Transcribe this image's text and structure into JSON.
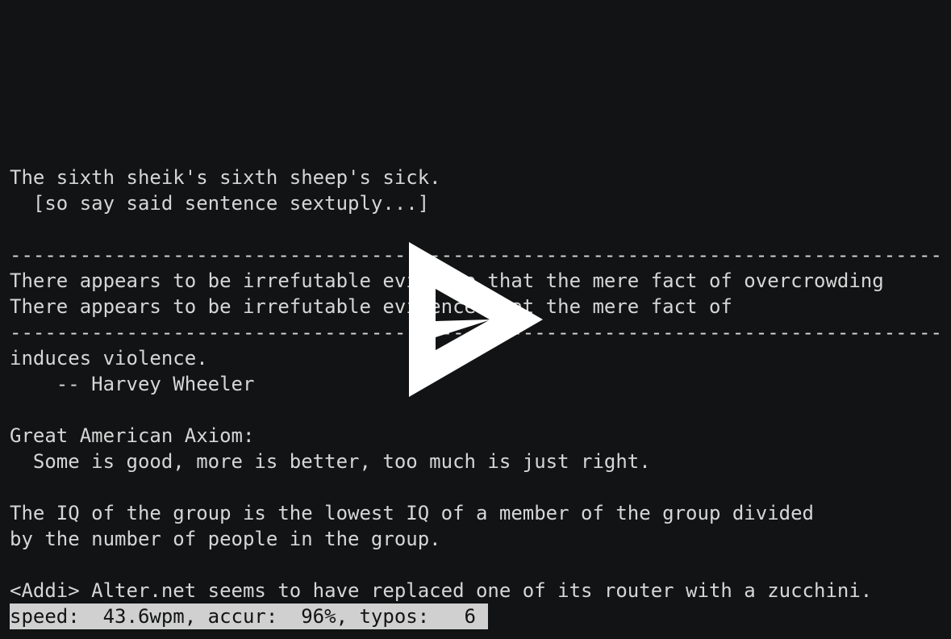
{
  "terminal": {
    "lines": [
      "The sixth sheik's sixth sheep's sick.",
      "  [so say said sentence sextuply...]",
      "",
      "--------------------------------------------------------------------------------",
      "There appears to be irrefutable evidence that the mere fact of overcrowding",
      "There appears to be irrefutable evidence that the mere fact of",
      "--------------------------------------------------------------------------------",
      "induces violence.",
      "    -- Harvey Wheeler",
      "",
      "Great American Axiom:",
      "  Some is good, more is better, too much is just right.",
      "",
      "The IQ of the group is the lowest IQ of a member of the group divided",
      "by the number of people in the group.",
      "",
      "<Addi> Alter.net seems to have replaced one of its router with a zucchini."
    ],
    "status": "speed:  43.6wpm, accur:  96%, typos:   6"
  },
  "overlay": {
    "icon": "asciinema-play-icon",
    "color": "#ffffff"
  },
  "colors": {
    "background": "#121314",
    "text": "#d6d6d6",
    "status_bg": "#d0d0d0"
  }
}
